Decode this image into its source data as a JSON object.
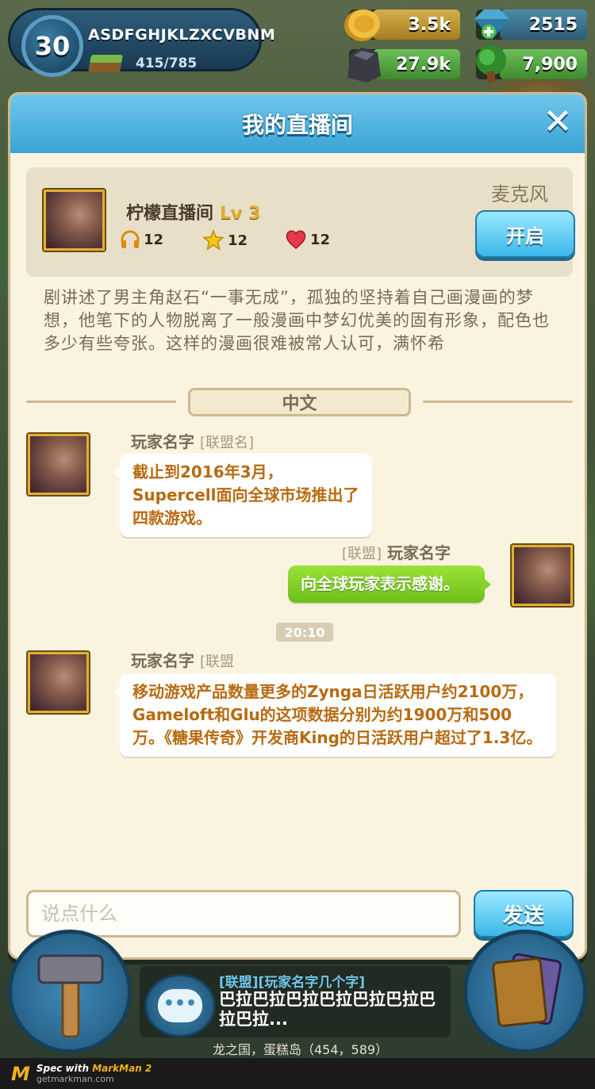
{
  "hud": {
    "level": "30",
    "player_name": "ASDFGHJKLZXCVBNM",
    "xp": "415/785",
    "gold": "3.5k",
    "gems": "2515",
    "stone": "27.9k",
    "wood": "7,900"
  },
  "panel": {
    "title": "我的直播间",
    "close": "✕"
  },
  "room": {
    "name": "柠檬直播间",
    "level": "Lv 3",
    "listeners": "12",
    "stars": "12",
    "likes": "12",
    "mic_label": "麦克风",
    "open_label": "开启"
  },
  "description": "剧讲述了男主角赵石“一事无成”，孤独的坚持着自己画漫画的梦想，他笔下的人物脱离了一般漫画中梦幻优美的固有形象，配色也多少有些夸张。这样的漫画很难被常人认可，满怀希",
  "language_tab": "中文",
  "messages": [
    {
      "sender": "玩家名字",
      "tag": "[联盟名]",
      "text": "截止到2016年3月，Supercell面向全球市场推出了四款游戏。"
    },
    {
      "sender": "玩家名字",
      "tag": "[联盟]",
      "text": "向全球玩家表示感谢。"
    },
    {
      "sender": "玩家名字",
      "tag": "[联盟",
      "text": "移动游戏产品数量更多的Zynga日活跃用户约2100万，Gameloft和Glu的这项数据分别为约1900万和500万。《糖果传奇》开发商King的日活跃用户超过了1.3亿。"
    }
  ],
  "time_divider": "20:10",
  "input": {
    "placeholder": "说点什么"
  },
  "send_label": "发送",
  "chat_bar": {
    "sender": "[联盟][玩家名字几个字]",
    "preview": "巴拉巴拉巴拉巴拉巴拉巴拉巴拉巴拉..."
  },
  "location": "龙之国，蛋糕岛（454，589）",
  "footer": {
    "brand": "Spec with",
    "brand_name": "MarkMan 2",
    "url": "getmarkman.com"
  }
}
